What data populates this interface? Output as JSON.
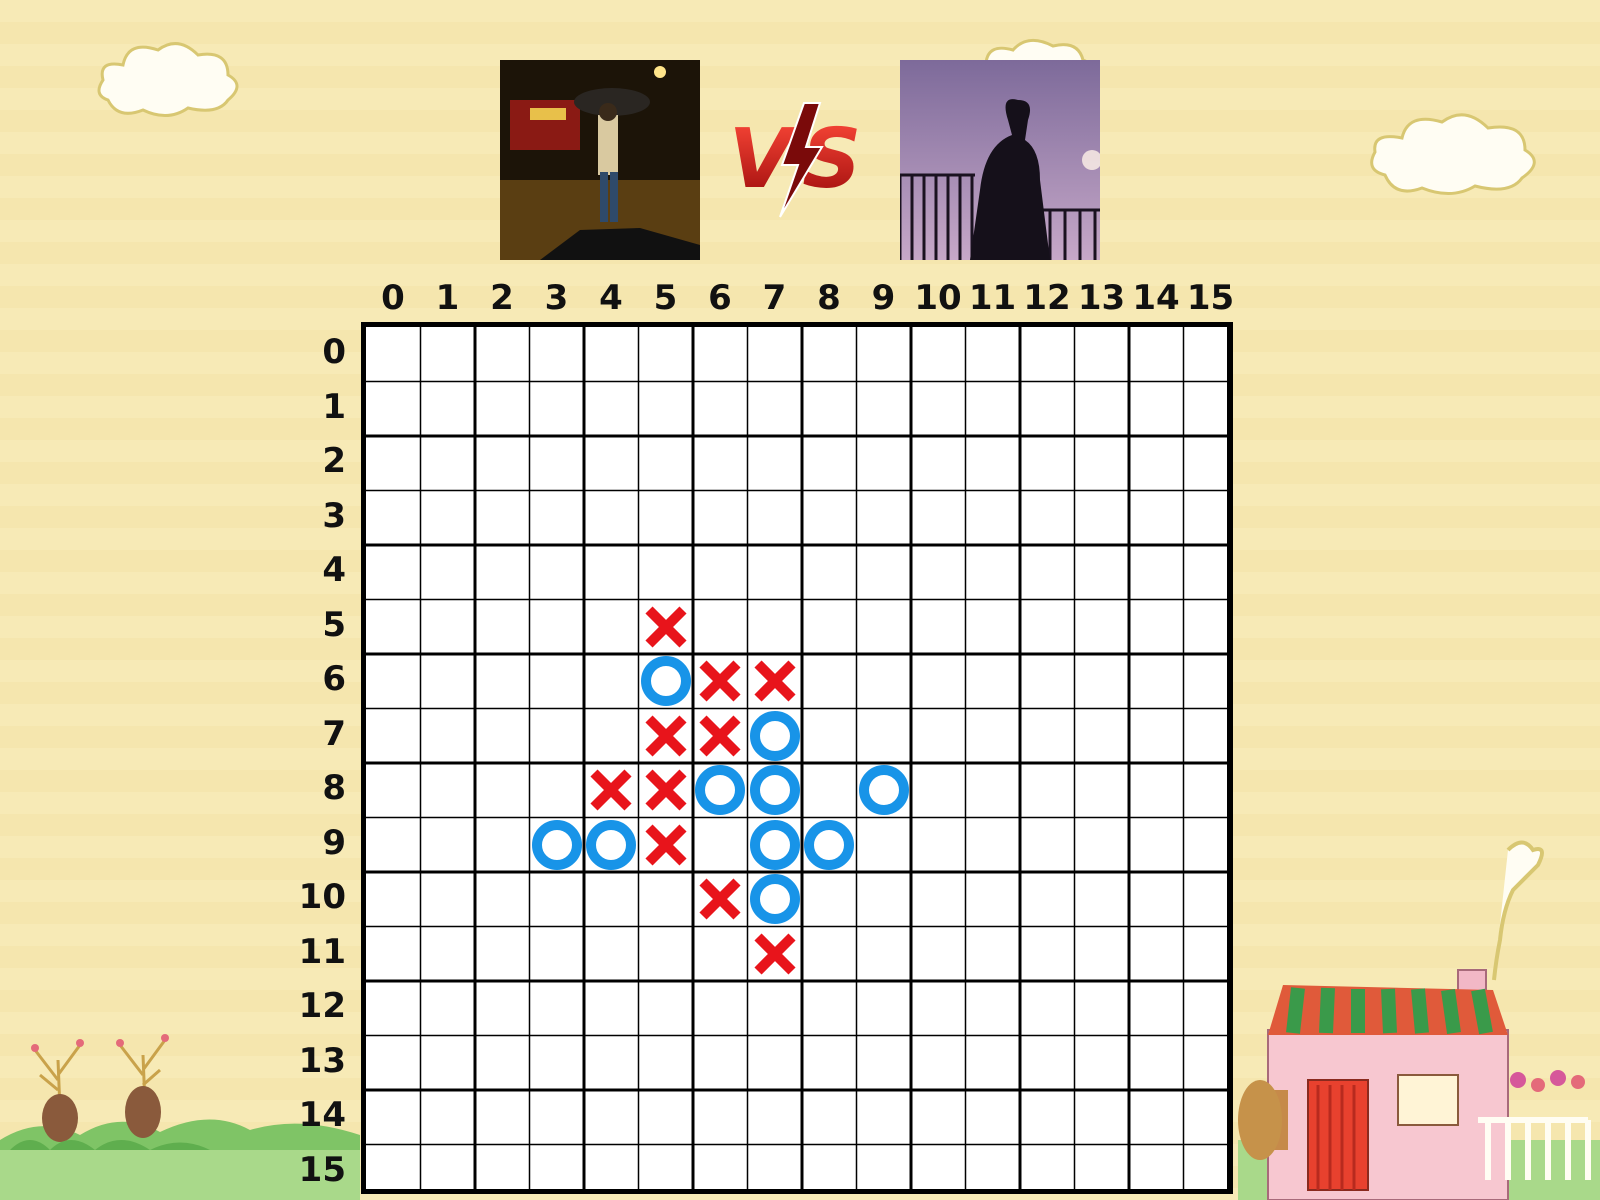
{
  "header": {
    "player1": {
      "avatar_name": "player1-avatar"
    },
    "vs_text": "VS",
    "player2": {
      "avatar_name": "player2-avatar"
    }
  },
  "board": {
    "size": 16,
    "column_labels": [
      "0",
      "1",
      "2",
      "3",
      "4",
      "5",
      "6",
      "7",
      "8",
      "9",
      "10",
      "11",
      "12",
      "13",
      "14",
      "15"
    ],
    "row_labels": [
      "0",
      "1",
      "2",
      "3",
      "4",
      "5",
      "6",
      "7",
      "8",
      "9",
      "10",
      "11",
      "12",
      "13",
      "14",
      "15"
    ],
    "x_color": "#e8141b",
    "o_color": "#1894e8",
    "pieces": [
      {
        "row": 5,
        "col": 5,
        "mark": "X"
      },
      {
        "row": 6,
        "col": 5,
        "mark": "O"
      },
      {
        "row": 6,
        "col": 6,
        "mark": "X"
      },
      {
        "row": 6,
        "col": 7,
        "mark": "X"
      },
      {
        "row": 7,
        "col": 5,
        "mark": "X"
      },
      {
        "row": 7,
        "col": 6,
        "mark": "X"
      },
      {
        "row": 7,
        "col": 7,
        "mark": "O"
      },
      {
        "row": 8,
        "col": 4,
        "mark": "X"
      },
      {
        "row": 8,
        "col": 5,
        "mark": "X"
      },
      {
        "row": 8,
        "col": 6,
        "mark": "O"
      },
      {
        "row": 8,
        "col": 7,
        "mark": "O"
      },
      {
        "row": 8,
        "col": 9,
        "mark": "O"
      },
      {
        "row": 9,
        "col": 3,
        "mark": "O"
      },
      {
        "row": 9,
        "col": 4,
        "mark": "O"
      },
      {
        "row": 9,
        "col": 5,
        "mark": "X"
      },
      {
        "row": 9,
        "col": 7,
        "mark": "O"
      },
      {
        "row": 9,
        "col": 8,
        "mark": "O"
      },
      {
        "row": 10,
        "col": 6,
        "mark": "X"
      },
      {
        "row": 10,
        "col": 7,
        "mark": "O"
      },
      {
        "row": 11,
        "col": 7,
        "mark": "X"
      }
    ]
  }
}
